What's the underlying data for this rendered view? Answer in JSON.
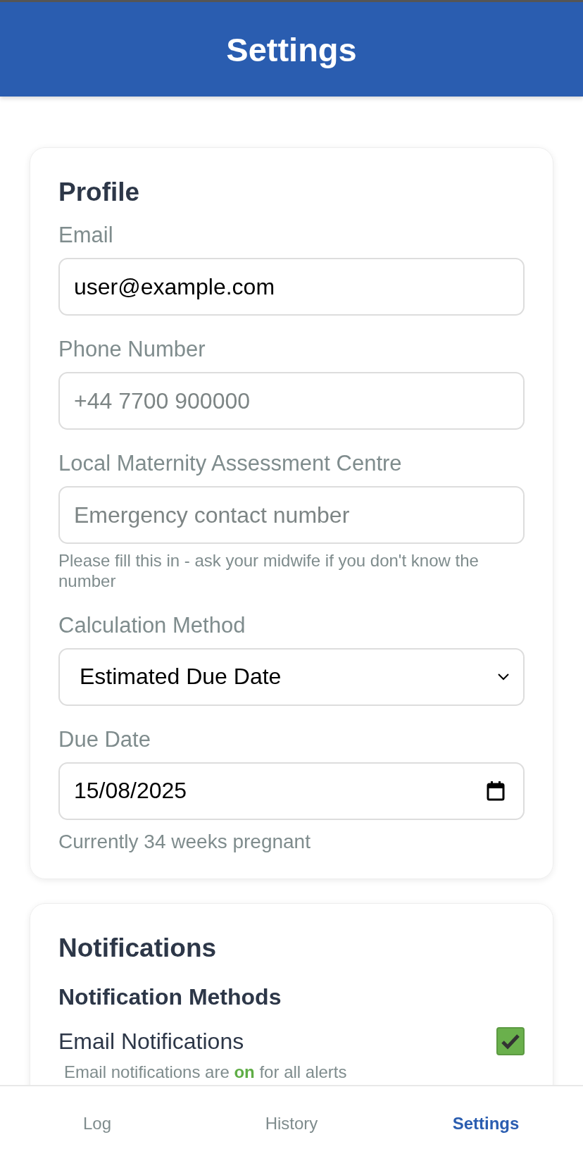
{
  "header": {
    "title": "Settings"
  },
  "profile": {
    "title": "Profile",
    "fields": [
      {
        "kind": "text",
        "label": "Email",
        "value": "user@example.com"
      },
      {
        "kind": "text",
        "label": "Phone Number",
        "placeholder": "+44 7700 900000"
      },
      {
        "kind": "text",
        "label": "Local Maternity Assessment Centre",
        "placeholder": "Emergency contact number",
        "note": "Please fill this in - ask your midwife if you don't know the number"
      },
      {
        "kind": "select",
        "label": "Calculation Method",
        "value": "Estimated Due Date"
      },
      {
        "kind": "date",
        "label": "Due Date",
        "value": "15/08/2025",
        "note": "Currently 34 weeks pregnant"
      }
    ]
  },
  "notifications": {
    "title": "Notifications",
    "subtitle": "Notification Methods",
    "items": [
      {
        "label": "Email Notifications",
        "checked": true,
        "description": "Email notifications are **on** for all alerts"
      }
    ]
  },
  "nav": [
    {
      "label": "Log",
      "selected": false
    },
    {
      "label": "History",
      "selected": false
    },
    {
      "label": "Settings",
      "selected": true
    }
  ]
}
